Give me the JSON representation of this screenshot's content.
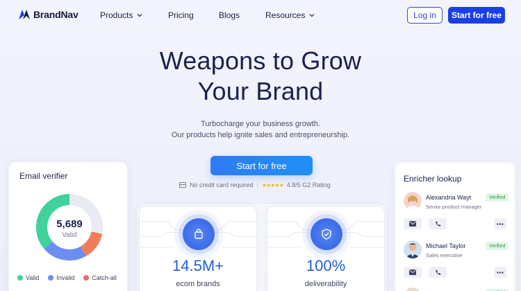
{
  "brand": {
    "name": "BrandNav",
    "accent": "#1b3fe6"
  },
  "nav": {
    "products": "Products",
    "pricing": "Pricing",
    "blogs": "Blogs",
    "resources": "Resources",
    "login": "Log in",
    "start": "Start for free"
  },
  "hero": {
    "title_line1": "Weapons to Grow",
    "title_line2": "Your Brand",
    "sub_line1": "Turbocharge your business growth.",
    "sub_line2": "Our products help ignite sales and entrepreneurship.",
    "cta": "Start for free",
    "no_card": "No credit card required",
    "rating_stars": "★★★★★",
    "rating": "4.8/5 G2 Rating"
  },
  "email_verifier": {
    "title": "Email verifier",
    "count": "5,689",
    "count_label": "Valid",
    "legend": [
      {
        "label": "Valid",
        "color": "#3fd29a"
      },
      {
        "label": "Invalid",
        "color": "#6b8ef0"
      },
      {
        "label": "Catch-all",
        "color": "#f26a6a"
      }
    ]
  },
  "stats": [
    {
      "value": "14.5M+",
      "label": "ecom brands",
      "icon": "shopping-bag-icon"
    },
    {
      "value": "100%",
      "label": "deliverability",
      "icon": "shield-check-icon"
    }
  ],
  "enricher": {
    "title": "Enricher lookup",
    "people": [
      {
        "name": "Alexandria Wayt",
        "role": "Senior product manager",
        "status": "Verified"
      },
      {
        "name": "Michael Taylor",
        "role": "Sales executive",
        "status": "Verified"
      }
    ]
  }
}
